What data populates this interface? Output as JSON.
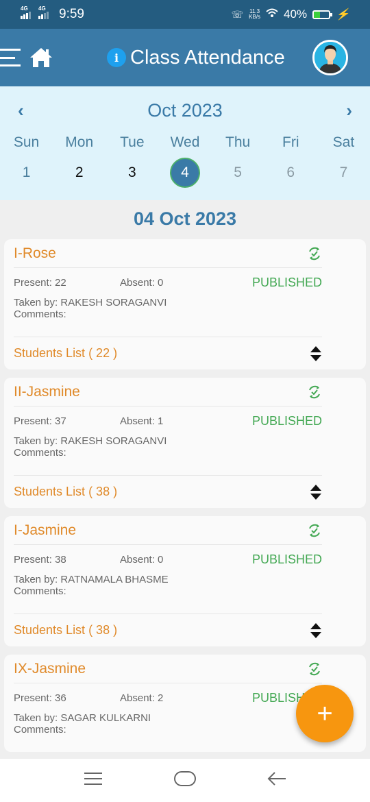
{
  "status_bar": {
    "sim1": "4G",
    "sim2": "4G",
    "time": "9:59",
    "net_speed_value": "11.3",
    "net_speed_unit": "KB/s",
    "battery": "40%",
    "battery_level": 0.4
  },
  "header": {
    "title": "Class Attendance",
    "info_icon": "i"
  },
  "calendar": {
    "month": "Oct 2023",
    "prev": "‹",
    "next": "›",
    "weekdays": [
      "Sun",
      "Mon",
      "Tue",
      "Wed",
      "Thu",
      "Fri",
      "Sat"
    ],
    "days": [
      "1",
      "2",
      "3",
      "4",
      "5",
      "6",
      "7"
    ],
    "selected_day": "4"
  },
  "selected_date": "04 Oct 2023",
  "cards": [
    {
      "class_name": "I-Rose",
      "present": "Present: 22",
      "absent": "Absent: 0",
      "status": "PUBLISHED",
      "taken_by": "Taken by: RAKESH SORAGANVI",
      "comments": "Comments:",
      "students_list": "Students List ( 22 )"
    },
    {
      "class_name": "II-Jasmine",
      "present": "Present: 37",
      "absent": "Absent: 1",
      "status": "PUBLISHED",
      "taken_by": "Taken by: RAKESH SORAGANVI",
      "comments": "Comments:",
      "students_list": "Students List ( 38 )"
    },
    {
      "class_name": "I-Jasmine",
      "present": "Present: 38",
      "absent": "Absent: 0",
      "status": "PUBLISHED",
      "taken_by": "Taken by: RATNAMALA BHASME",
      "comments": "Comments:",
      "students_list": "Students List ( 38 )"
    },
    {
      "class_name": "IX-Jasmine",
      "present": "Present: 36",
      "absent": "Absent: 2",
      "status": "PUBLISHED",
      "taken_by": "Taken by: SAGAR KULKARNI",
      "comments": "Comments:"
    }
  ],
  "fab": {
    "label": "+"
  },
  "colors": {
    "primary": "#3a7aa7",
    "accent_orange": "#e08a2a",
    "published_green": "#43a853",
    "fab_orange": "#f7960f"
  }
}
